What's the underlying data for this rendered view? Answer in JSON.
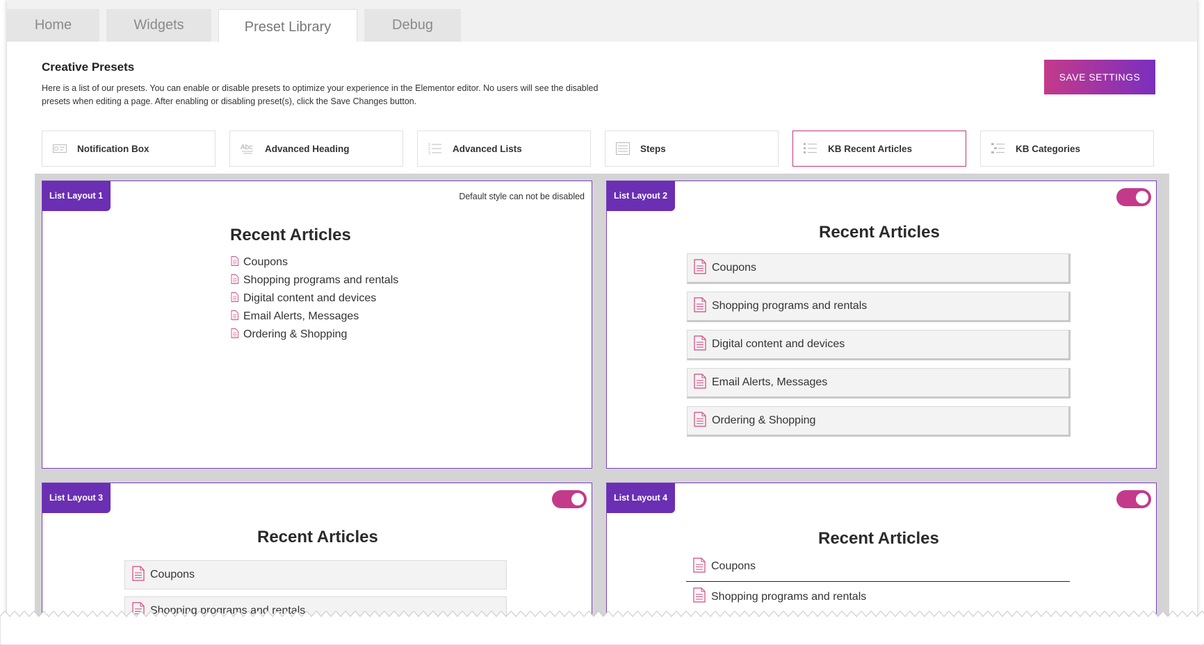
{
  "tabs": [
    {
      "label": "Home"
    },
    {
      "label": "Widgets"
    },
    {
      "label": "Preset Library"
    },
    {
      "label": "Debug"
    }
  ],
  "header": {
    "title": "Creative Presets",
    "description": "Here is a list of our presets. You can enable or disable presets to optimize your experience in the Elementor editor. No users will see the disabled presets when editing a page. After enabling or disabling preset(s), click the Save Changes button.",
    "save_label": "SAVE SETTINGS"
  },
  "presets": [
    {
      "label": "Notification Box",
      "icon": "notification-box-icon"
    },
    {
      "label": "Advanced Heading",
      "icon": "advanced-heading-icon"
    },
    {
      "label": "Advanced Lists",
      "icon": "advanced-lists-icon"
    },
    {
      "label": "Steps",
      "icon": "steps-icon"
    },
    {
      "label": "KB Recent Articles",
      "icon": "kb-recent-articles-icon"
    },
    {
      "label": "KB Categories",
      "icon": "kb-categories-icon"
    }
  ],
  "layouts": [
    {
      "badge": "List Layout 1",
      "note": "Default style can not be disabled",
      "title": "Recent Articles",
      "articles": [
        "Coupons",
        "Shopping programs and rentals",
        "Digital content and devices",
        "Email Alerts, Messages",
        "Ordering & Shopping"
      ]
    },
    {
      "badge": "List Layout 2",
      "title": "Recent Articles",
      "articles": [
        "Coupons",
        "Shopping programs and rentals",
        "Digital content and devices",
        "Email Alerts, Messages",
        "Ordering & Shopping"
      ]
    },
    {
      "badge": "List Layout 3",
      "title": "Recent Articles",
      "articles": [
        "Coupons",
        "Shopping programs and rentals"
      ]
    },
    {
      "badge": "List Layout 4",
      "title": "Recent Articles",
      "articles": [
        "Coupons",
        "Shopping programs and rentals"
      ]
    }
  ],
  "colors": {
    "accent_pink": "#c43a8a",
    "accent_purple": "#6a2fb3",
    "active_border": "#c0357e",
    "doc_icon": "#d0477e"
  }
}
